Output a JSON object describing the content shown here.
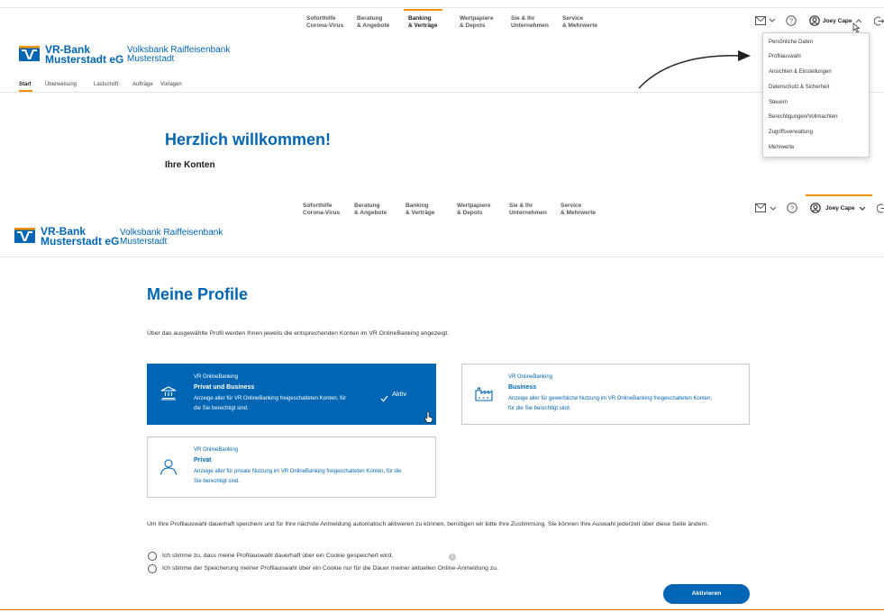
{
  "nav": {
    "items": [
      {
        "line1": "Soforthilfe",
        "line2": "Corona-Virus"
      },
      {
        "line1": "Beratung",
        "line2": "& Angebote"
      },
      {
        "line1": "Banking",
        "line2": "& Verträge"
      },
      {
        "line1": "Wertpapiere",
        "line2": "& Depots"
      },
      {
        "line1": "Sie & Ihr",
        "line2": "Unternehmen"
      },
      {
        "line1": "Service",
        "line2": "& Mehrwerte"
      }
    ],
    "active_index": 2
  },
  "brand": {
    "line1": "VR-Bank",
    "line2": "Musterstadt eG",
    "sub1": "Volksbank Raiffeisenbank",
    "sub2": "Musterstadt",
    "color": "#0066b3",
    "accent": "#f39200"
  },
  "user": {
    "name": "Joey Cape"
  },
  "subnav": {
    "items": [
      "Start",
      "Überweisung",
      "Lastschrift",
      "Aufträge",
      "Vorlagen"
    ],
    "active": "Start"
  },
  "welcome": {
    "title": "Herzlich willkommen!",
    "subtitle": "Ihre Konten"
  },
  "dropdown": {
    "items": [
      "Persönliche Daten",
      "Profilauswahl",
      "Ansichten & Einstellungen",
      "Datenschutz & Sicherheit",
      "Steuern",
      "Berechtigungen/Vollmachten",
      "Zugriffsverwaltung",
      "Mehrwerte"
    ]
  },
  "profiles": {
    "title": "Meine Profile",
    "intro": "Über das ausgewählte Profil werden Ihnen jeweils die entsprechenden Konten im VR OnlineBanking angezeigt.",
    "cards": [
      {
        "type": "VR OnlineBanking",
        "title": "Privat und Business",
        "desc1": "Anzeige aller für VR OnlineBanking freigeschalteten Konten, für",
        "desc2": "die Sie berechtigt sind.",
        "status": "Aktiv",
        "icon": "bank-building-icon"
      },
      {
        "type": "VR OnlineBanking",
        "title": "Business",
        "desc1": "Anzeige aller für gewerbliche Nutzung im VR OnlineBanking freigeschalteten Konten,",
        "desc2": "für die Sie berechtigt sind.",
        "icon": "factory-icon"
      },
      {
        "type": "VR OnlineBanking",
        "title": "Privat",
        "desc1": "Anzeige aller für private Nutzung im VR OnlineBanking freigeschalteten Konten, für die",
        "desc2": "Sie berechtigt sind.",
        "icon": "person-icon"
      }
    ],
    "consent": "Um Ihre Profilauswahl dauerhaft speichern und für Ihre nächste Anmeldung automatisch aktivieren zu können, benötigen wir bitte Ihre Zustimmung. Sie können Ihre Auswahl jederzeit über diese Seite ändern.",
    "option1": "Ich stimme zu, dass meine Profilauswahl dauerhaft über ein Cookie gespeichert wird.",
    "option2": "Ich stimme der Speicherung meiner Profilauswahl über ein Cookie nur für die Dauer meiner aktuellen Online-Anmeldung zu.",
    "info_glyph": "i",
    "button": "Aktivieren"
  }
}
